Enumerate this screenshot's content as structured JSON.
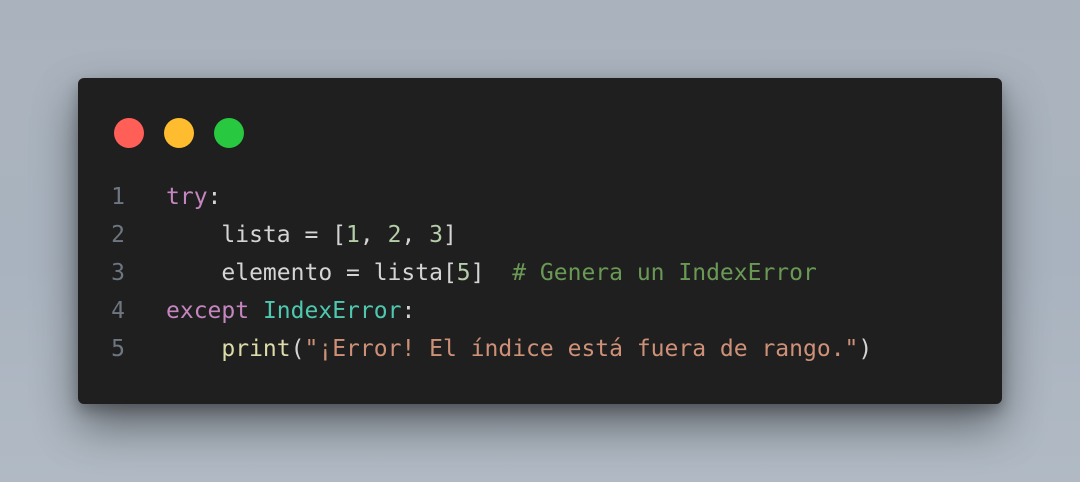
{
  "window": {
    "dots": [
      {
        "name": "close",
        "color": "#ff5f57"
      },
      {
        "name": "minimize",
        "color": "#febc2e"
      },
      {
        "name": "maximize",
        "color": "#28c840"
      }
    ]
  },
  "code": {
    "language": "python",
    "lines": [
      {
        "number": "1",
        "tokens": [
          {
            "text": "try",
            "kind": "kw"
          },
          {
            "text": ":",
            "kind": "pl"
          }
        ]
      },
      {
        "number": "2",
        "tokens": [
          {
            "text": "    lista = [",
            "kind": "pl"
          },
          {
            "text": "1",
            "kind": "num"
          },
          {
            "text": ", ",
            "kind": "pl"
          },
          {
            "text": "2",
            "kind": "num"
          },
          {
            "text": ", ",
            "kind": "pl"
          },
          {
            "text": "3",
            "kind": "num"
          },
          {
            "text": "]",
            "kind": "pl"
          }
        ]
      },
      {
        "number": "3",
        "tokens": [
          {
            "text": "    elemento = lista[",
            "kind": "pl"
          },
          {
            "text": "5",
            "kind": "num"
          },
          {
            "text": "]  ",
            "kind": "pl"
          },
          {
            "text": "# Genera un IndexError",
            "kind": "cmt"
          }
        ]
      },
      {
        "number": "4",
        "tokens": [
          {
            "text": "except",
            "kind": "kw"
          },
          {
            "text": " ",
            "kind": "pl"
          },
          {
            "text": "IndexError",
            "kind": "cls"
          },
          {
            "text": ":",
            "kind": "pl"
          }
        ]
      },
      {
        "number": "5",
        "tokens": [
          {
            "text": "    ",
            "kind": "pl"
          },
          {
            "text": "print",
            "kind": "fn"
          },
          {
            "text": "(",
            "kind": "pl"
          },
          {
            "text": "\"¡Error! El índice está fuera de rango.\"",
            "kind": "str"
          },
          {
            "text": ")",
            "kind": "pl"
          }
        ]
      }
    ]
  }
}
